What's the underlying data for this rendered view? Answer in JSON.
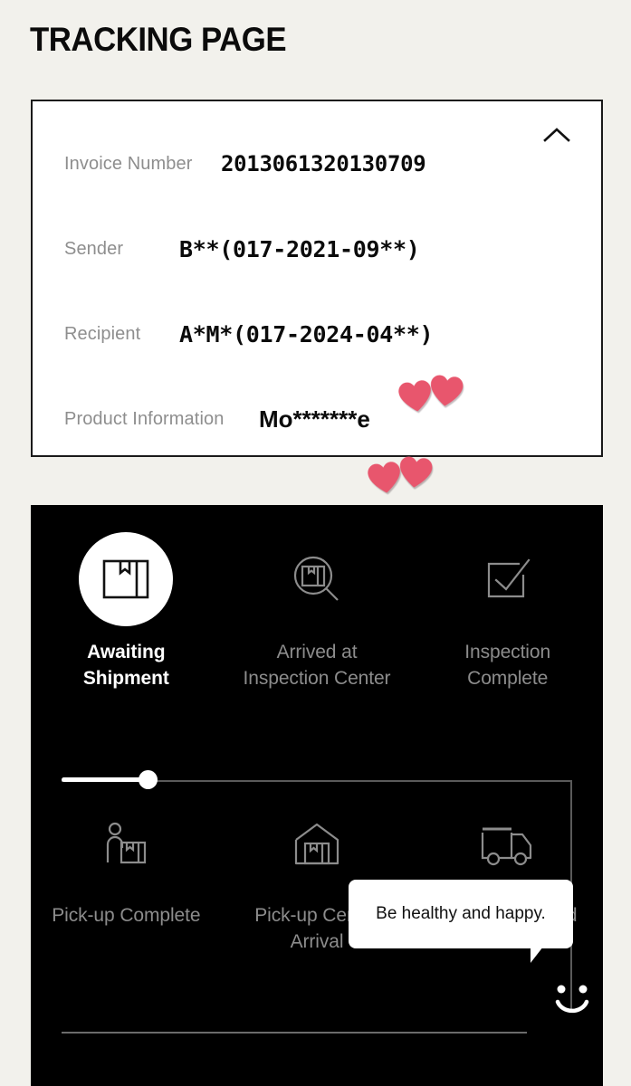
{
  "page": {
    "title": "TRACKING PAGE",
    "background_color": "#F2F1EC"
  },
  "invoice_card": {
    "collapse_icon": "chevron-up-icon",
    "rows": [
      {
        "label": "Invoice Number",
        "value": "2013061320130709"
      },
      {
        "label": "Sender",
        "value": "B**(017-2021-09**)"
      },
      {
        "label": "Recipient",
        "value": "A*M*(017-2024-04**)"
      },
      {
        "label": "Product Information",
        "value": "Mo*******e"
      }
    ],
    "decorations": [
      {
        "name": "heart-emoji-pair",
        "on_row": "Recipient",
        "color": "#E8566D"
      },
      {
        "name": "heart-emoji-pair",
        "on_row": "Product Information",
        "color": "#E8566D"
      }
    ]
  },
  "tracking": {
    "background_color": "#000000",
    "active_step_index": 0,
    "progress_percent": 17,
    "steps_top": [
      {
        "label": "Awaiting Shipment",
        "icon": "package-box-icon",
        "state": "active"
      },
      {
        "label": "Arrived at Inspection Center",
        "icon": "magnifier-box-icon",
        "state": "pending"
      },
      {
        "label": "Inspection Complete",
        "icon": "checked-square-icon",
        "state": "pending"
      }
    ],
    "steps_bottom": [
      {
        "label": "Pick-up Complete",
        "icon": "person-with-box-icon",
        "state": "pending"
      },
      {
        "label": "Pick-up Center Arrival",
        "icon": "warehouse-box-icon",
        "state": "pending"
      },
      {
        "label": "Shipping Started",
        "icon": "delivery-truck-icon",
        "state": "pending"
      }
    ],
    "tooltip": {
      "text": "Be healthy and happy."
    },
    "smiley_icon": "smiley-face-icon"
  }
}
